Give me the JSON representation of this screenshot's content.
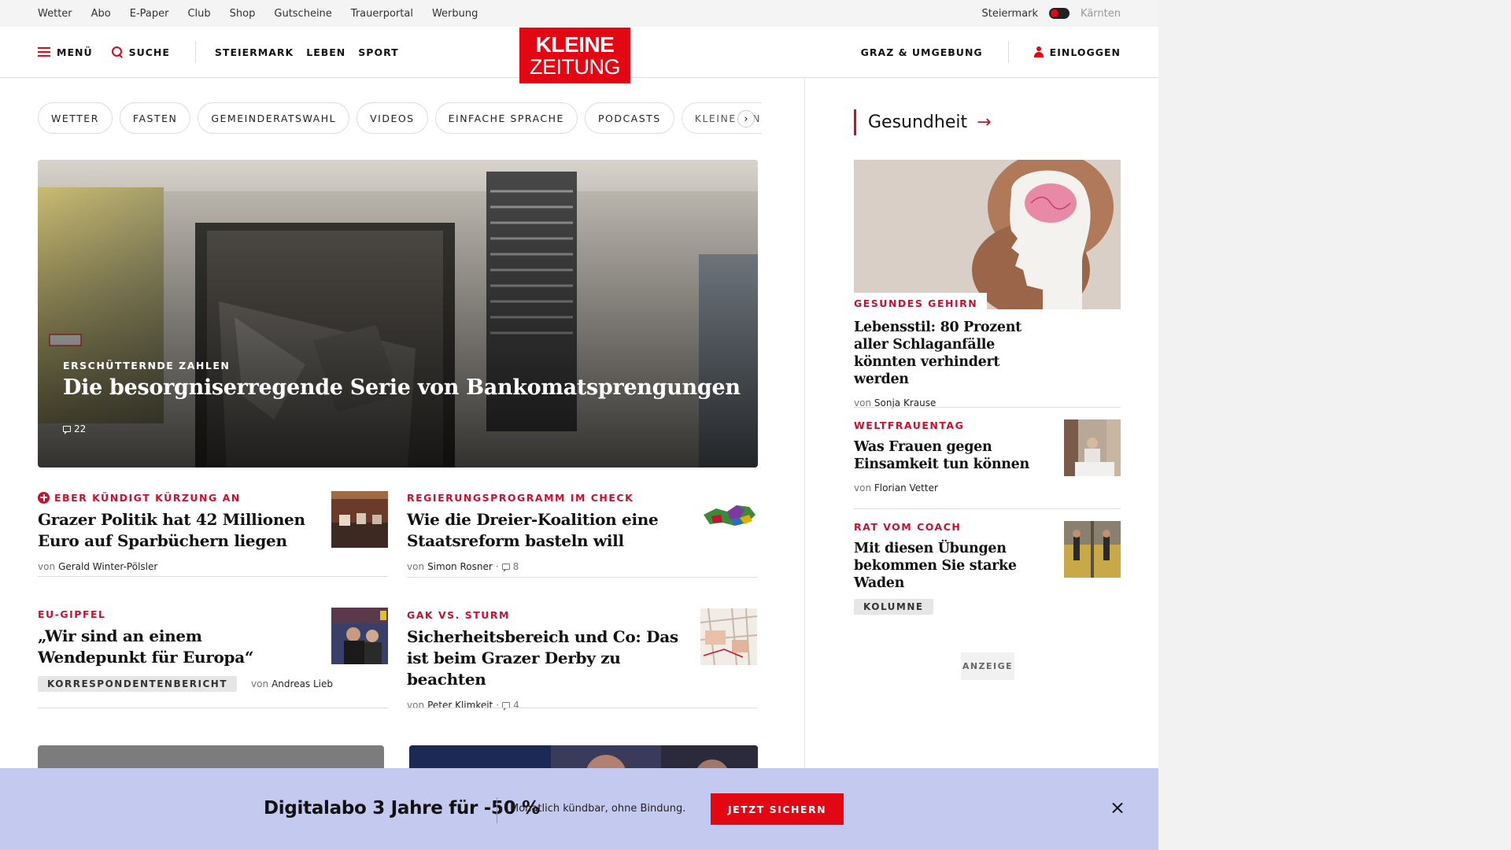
{
  "utility": {
    "links": [
      "Wetter",
      "Abo",
      "E-Paper",
      "Club",
      "Shop",
      "Gutscheine",
      "Trauerportal",
      "Werbung"
    ],
    "region_active": "Steiermark",
    "region_other": "Kärnten"
  },
  "header": {
    "menu_label": "MENÜ",
    "search_label": "SUCHE",
    "nav": [
      "STEIERMARK",
      "LEBEN",
      "SPORT"
    ],
    "logo_line1": "KLEINE",
    "logo_line2": "ZEITUNG",
    "region_link": "GRAZ & UMGEBUNG",
    "login_label": "EINLOGGEN"
  },
  "chips": [
    "WETTER",
    "FASTEN",
    "GEMEINDERATSWAHL",
    "VIDEOS",
    "EINFACHE SPRACHE",
    "PODCASTS",
    "KLEINE KINDE"
  ],
  "chips_next": "›",
  "hero": {
    "kicker": "ERSCHÜTTERNDE ZAHLEN",
    "title": "Die besorgniserregende Serie von Bankomatsprengungen",
    "comments": "22"
  },
  "articles": [
    {
      "kicker": "EBER KÜNDIGT KÜRZUNG AN",
      "plus": true,
      "title": "Grazer Politik hat 42 Millionen Euro auf Sparbüchern liegen",
      "by": "von",
      "author": "Gerald Winter-Pölsler",
      "comments": ""
    },
    {
      "kicker": "REGIERUNGSPROGRAMM IM CHECK",
      "plus": false,
      "title": "Wie die Dreier-Koalition eine Staatsreform basteln will",
      "by": "von",
      "author": "Simon Rosner",
      "comments": "8"
    },
    {
      "kicker": "EU-GIPFEL",
      "plus": false,
      "title": "„Wir sind an einem Wendepunkt für Europa“",
      "tag": "KORRESPONDENTENBERICHT",
      "by": "von",
      "author": "Andreas Lieb",
      "comments": ""
    },
    {
      "kicker": "GAK VS. STURM",
      "plus": false,
      "title": "Sicherheitsbereich und Co: Das ist beim Grazer Derby zu beachten",
      "by": "von",
      "author": "Peter Klimkeit",
      "comments": "4"
    }
  ],
  "sidebar": {
    "section": "Gesundheit",
    "arrow": "→",
    "lead": {
      "kicker": "GESUNDES GEHIRN",
      "title": "Lebensstil: 80 Prozent aller Schlaganfälle könnten verhindert werden",
      "by": "von",
      "author": "Sonja Krause"
    },
    "items": [
      {
        "kicker": "WELTFRAUENTAG",
        "title": "Was Frauen gegen Einsamkeit tun können",
        "by": "von",
        "author": "Florian Vetter"
      },
      {
        "kicker": "RAT VOM COACH",
        "title": "Mit diesen Übungen bekommen Sie starke Waden",
        "tag": "KOLUMNE"
      }
    ],
    "ad_label": "ANZEIGE"
  },
  "promo": {
    "headline": "Digitalabo 3 Jahre für -50 %",
    "sub": "Monatlich kündbar, ohne Bindung.",
    "cta": "JETZT SICHERN"
  },
  "colors": {
    "brand_red": "#e30613",
    "kicker_red": "#c8102e",
    "promo_bg": "#c4c9ef"
  }
}
